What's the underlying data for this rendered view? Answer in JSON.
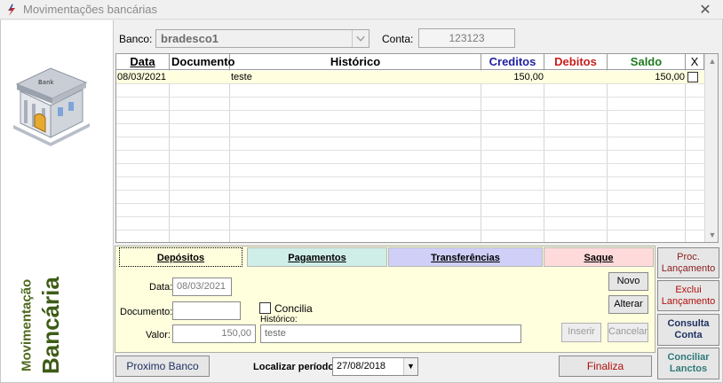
{
  "window": {
    "title": "Movimentações bancárias"
  },
  "sidebar": {
    "title_line1": "Movimentação",
    "title_line2": "Bancária",
    "logo_text": "Bank"
  },
  "filters": {
    "banco_label": "Banco:",
    "banco_value": "bradesco1",
    "conta_label": "Conta:",
    "conta_value": "123123"
  },
  "grid": {
    "columns": [
      {
        "label": "Data",
        "color": "#000000"
      },
      {
        "label": "Documento",
        "color": "#000000"
      },
      {
        "label": "Histórico",
        "color": "#000000"
      },
      {
        "label": "Creditos",
        "color": "#1f1f9f"
      },
      {
        "label": "Debitos",
        "color": "#c81e1e"
      },
      {
        "label": "Saldo",
        "color": "#207a20"
      },
      {
        "label": "X",
        "color": "#000000"
      }
    ],
    "rows": [
      {
        "data": "08/03/2021",
        "documento": "",
        "historico": "teste",
        "creditos": "150,00",
        "debitos": "",
        "saldo": "150,00",
        "checked": false
      }
    ]
  },
  "tabs": [
    {
      "label": "Depósitos",
      "color": "#ffffde"
    },
    {
      "label": "Pagamentos",
      "color": "#cfeee8"
    },
    {
      "label": "Transferências",
      "color": "#cfcff8"
    },
    {
      "label": "Saque",
      "color": "#ffdada"
    }
  ],
  "form": {
    "data_label": "Data:",
    "data_value": "08/03/2021",
    "documento_label": "Documento:",
    "documento_value": "",
    "concilia_label": "Concilia",
    "historico_label": "Histórico:",
    "historico_value": "teste",
    "valor_label": "Valor:",
    "valor_value": "150,00",
    "novo_label": "Novo",
    "alterar_label": "Alterar",
    "inserir_label": "Inserir",
    "cancelar_label": "Cancelar"
  },
  "side_buttons": {
    "proc_line1": "Proc.",
    "proc_line2": "Lançamento",
    "exclui_line1": "Exclui",
    "exclui_line2": "Lançamento",
    "consulta_line1": "Consulta",
    "consulta_line2": "Conta",
    "conciliar_line1": "Conciliar",
    "conciliar_line2": "Lanctos"
  },
  "footer": {
    "proximo_label": "Proximo Banco",
    "localizar_label": "Localizar período:",
    "periodo_value": "27/08/2018",
    "finaliza_label": "Finaliza"
  }
}
